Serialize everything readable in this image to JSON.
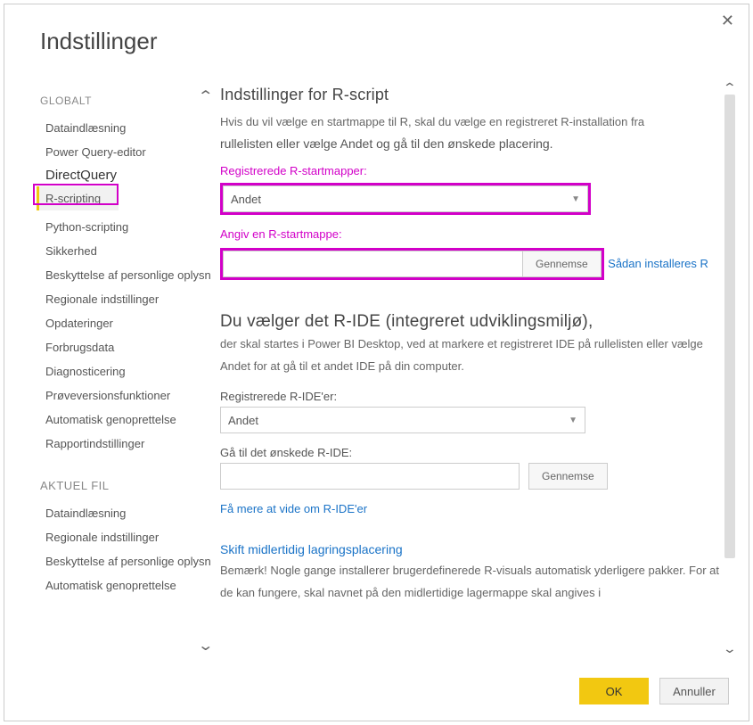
{
  "window": {
    "title": "Indstillinger"
  },
  "sidebar": {
    "global_header": "GLOBALT",
    "items": [
      "Dataindlæsning",
      "Power Query-editor",
      "DirectQuery",
      "R-scripting",
      "Python-scripting",
      "Sikkerhed",
      "Beskyttelse af personlige oplysninger",
      "Regionale indstillinger",
      "Opdateringer",
      "Forbrugsdata",
      "Diagnosticering",
      "Prøveversionsfunktioner",
      "Automatisk genoprettelse",
      "Rapportindstillinger"
    ],
    "current_header": "AKTUEL FIL",
    "current_items": [
      "Dataindlæsning",
      "Regionale indstillinger",
      "Beskyttelse af personlige oplysninger",
      "Automatisk genoprettelse"
    ]
  },
  "main": {
    "rscript": {
      "heading": "Indstillinger for R-script",
      "desc1": "Hvis du vil vælge en startmappe til R, skal du vælge en registreret R-installation fra",
      "desc2": "rullelisten eller vælge Andet og gå til den ønskede placering.",
      "label_detected": "Registrerede R-startmapper:",
      "select_detected": "Andet",
      "label_home": "Angiv en R-startmappe:",
      "home_value": "",
      "browse": "Gennemse",
      "link_install": "Sådan installeres R"
    },
    "ride": {
      "heading": "Du vælger det R-IDE (integreret udviklingsmiljø),",
      "desc1": "der skal startes i Power BI Desktop, ved at markere et registreret IDE på rullelisten eller vælge Andet for at gå til et andet IDE på din computer.",
      "label_detected": "Registrerede R-IDE'er:",
      "select_detected": "Andet",
      "label_goto": "Gå til det ønskede R-IDE:",
      "goto_value": "",
      "browse": "Gennemse",
      "link_more": "Få mere at vide om R-IDE'er"
    },
    "storage": {
      "heading": "Skift midlertidig lagringsplacering",
      "desc1": "Bemærk! Nogle gange installerer brugerdefinerede R-visuals automatisk yderligere pakker. For at de kan fungere, skal navnet på den midlertidige lagermappe skal angives i"
    }
  },
  "footer": {
    "ok": "OK",
    "cancel": "Annuller"
  }
}
